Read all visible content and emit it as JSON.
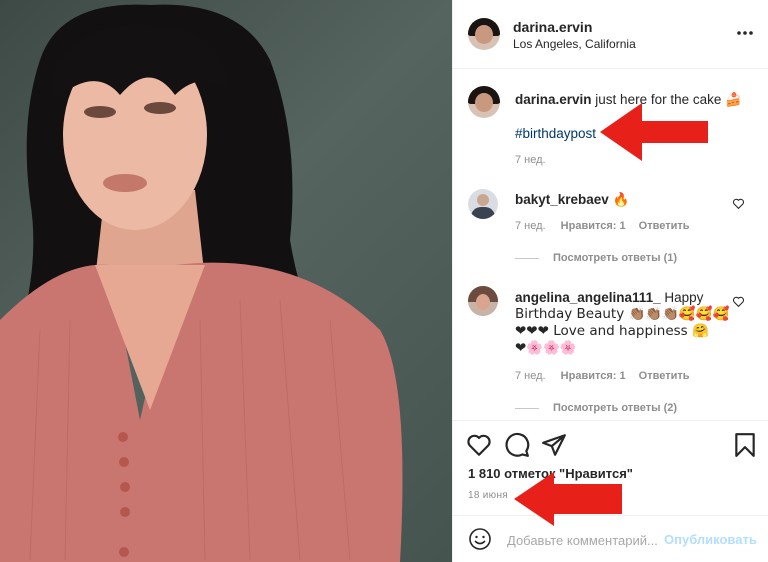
{
  "post": {
    "author": "darina.ervin",
    "location": "Los Angeles, California",
    "more_icon": "more-horizontal-icon"
  },
  "caption": {
    "author": "darina.ervin",
    "text": "just here for the cake 🍰",
    "hashtag": "#birthdaypost",
    "time": "7 нед."
  },
  "comments": [
    {
      "author": "bakyt_krebaev",
      "text": "🔥",
      "time": "7 нед.",
      "likes": "Нравится: 1",
      "reply": "Ответить",
      "view_replies": "Посмотреть ответы (1)"
    },
    {
      "author": "angelina_angelina111_",
      "text_line1": "Happy",
      "text_line2": "Birthday Beauty 👏🏽👏🏽👏🏽🥰🥰🥰",
      "text_line3": "❤❤❤ Love and happiness 🤗",
      "text_line4": "❤🌸🌸🌸",
      "time": "7 нед.",
      "likes": "Нравится: 1",
      "reply": "Ответить",
      "view_replies": "Посмотреть ответы (2)"
    }
  ],
  "likes_text": "1 810 отметок \"Нравится\"",
  "date": "18 июня",
  "add_comment": {
    "placeholder": "Добавьте комментарий...",
    "publish": "Опубликовать"
  },
  "colors": {
    "arrow": "#e8201a",
    "link": "#00376b",
    "publish": "#b2dffc"
  }
}
